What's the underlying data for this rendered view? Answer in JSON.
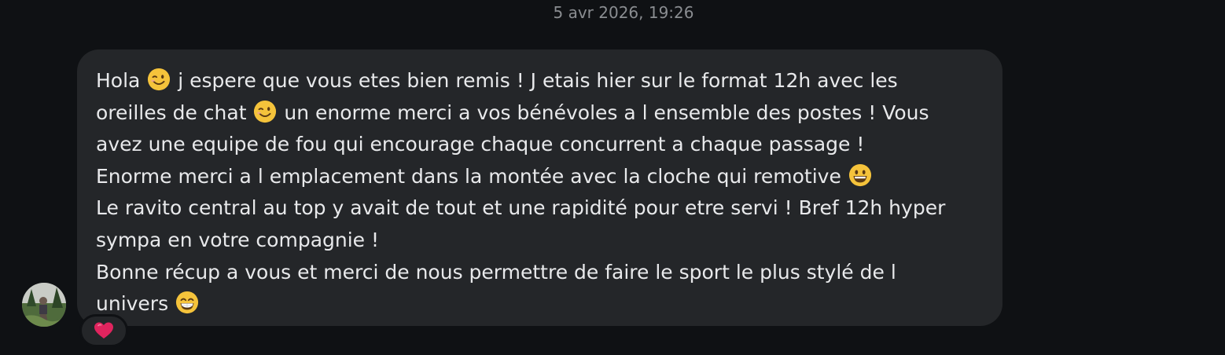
{
  "conversation": {
    "timestamp": "5 avr 2026, 19:26"
  },
  "message": {
    "lines": [
      {
        "parts": [
          "Hola ",
          {
            "icon": "wink-emoji"
          },
          " j espere que vous etes bien remis ! J etais hier sur le format 12h avec les"
        ]
      },
      {
        "parts": [
          "oreilles de chat ",
          {
            "icon": "wink-emoji"
          },
          " un enorme merci a vos bénévoles a l ensemble des postes ! Vous"
        ]
      },
      {
        "parts": [
          "avez une equipe de fou qui encourage chaque concurrent a chaque passage !"
        ]
      },
      {
        "parts": [
          "Enorme merci a l emplacement dans la montée avec la cloche qui remotive ",
          {
            "icon": "grinning-emoji"
          }
        ]
      },
      {
        "parts": [
          "Le ravito central au top y avait de tout et une rapidité pour etre servi ! Bref 12h hyper"
        ]
      },
      {
        "parts": [
          "sympa en votre compagnie !"
        ]
      },
      {
        "parts": [
          "Bonne récup a vous et merci de nous permettre de faire le sport le plus stylé de l"
        ]
      },
      {
        "parts": [
          "univers ",
          {
            "icon": "beaming-smile-emoji"
          }
        ]
      }
    ]
  },
  "sender": {
    "avatar_icon": "profile-photo"
  },
  "reaction": {
    "icon": "heart-icon",
    "color": "#e0245e"
  },
  "colors": {
    "background": "#0f1114",
    "bubble": "#242629",
    "text": "#e8e9eb",
    "timestamp": "#8a8d91",
    "emoji_face": "#f5c33b"
  }
}
